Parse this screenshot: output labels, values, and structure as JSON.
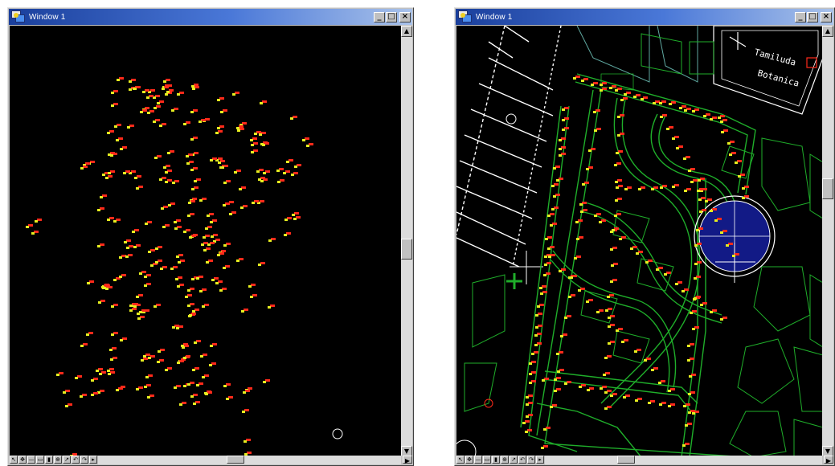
{
  "windows": [
    {
      "title": "Window 1",
      "buttons": {
        "minimize": "_",
        "maximize": "□",
        "close": "×"
      },
      "view": "points-only"
    },
    {
      "title": "Window 1",
      "buttons": {
        "minimize": "_",
        "maximize": "□",
        "close": "×"
      },
      "view": "cad-garden-plan"
    }
  ],
  "drawing_labels": {
    "label_top": "Tamiluda",
    "label_bottom": "Botanica"
  },
  "colors": {
    "canvas": "#000000",
    "marker_red": "#ff2a1a",
    "marker_yellow": "#e6ee20",
    "cad_green": "#1fae2a",
    "cad_teal": "#5fa8a0",
    "pond_blue": "#121a86",
    "cad_white": "#ffffff"
  },
  "toolbar_icons": [
    "arrow-icon",
    "move-icon",
    "line-icon",
    "rect-icon",
    "chart-icon",
    "zoom-icon",
    "pan-icon",
    "undo-icon",
    "redo-icon",
    "fit-icon"
  ]
}
